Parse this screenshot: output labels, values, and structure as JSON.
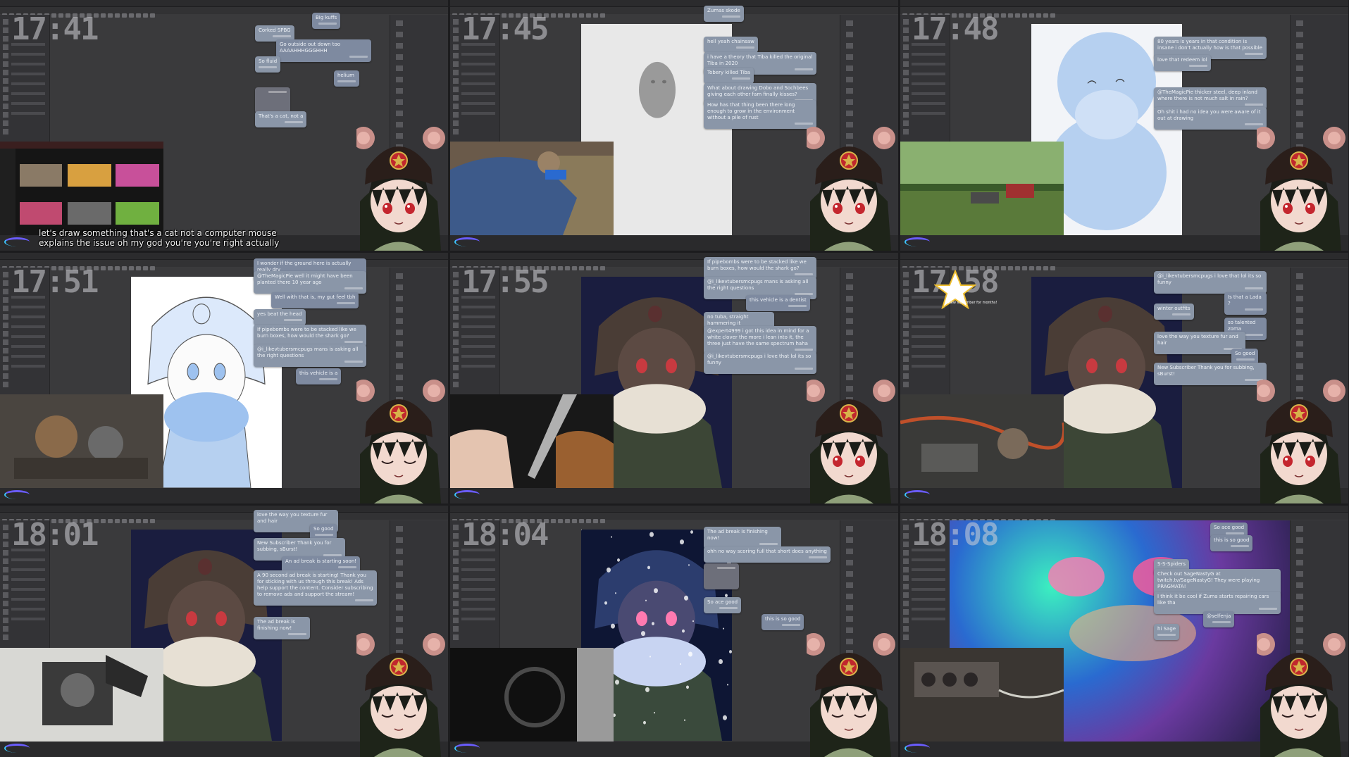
{
  "panels": [
    {
      "timer": "17:41",
      "canvas_theme": "dark",
      "subtitles": [
        "let's draw something that's a cat not a computer mouse",
        "explains the issue oh my god you're you're right actually"
      ],
      "chat": [
        {
          "side": "right",
          "text": "Big kuffs"
        },
        {
          "side": "left",
          "text": "Corked SPBG"
        },
        {
          "side": "right",
          "text": "Go outside out down too AAAAHHHGGGHHH"
        },
        {
          "side": "left",
          "text": "So fluid"
        },
        {
          "side": "right",
          "text": "helium"
        },
        {
          "side": "left",
          "text": ""
        },
        {
          "side": "left",
          "text": "That's a cat, not a"
        }
      ],
      "video": "browser-window"
    },
    {
      "timer": "17:45",
      "canvas_theme": "sketch-grey",
      "subtitles": [],
      "chat": [
        {
          "side": "left",
          "text": "Zumas skode"
        },
        {
          "side": "left",
          "text": "hell yeah chainsaw"
        },
        {
          "side": "left",
          "text": "i have a theory that Tiba killed the original Tiba in 2020"
        },
        {
          "side": "left",
          "text": "Tobery killed Tiba"
        },
        {
          "side": "left",
          "text": "What about drawing Dobo and Sochbees giving each other fam finally kisses?"
        },
        {
          "side": "left",
          "text": "How has that thing been there long enough to grow in the environment without a pile of rust"
        }
      ],
      "video": "chainsaw-worker"
    },
    {
      "timer": "17:48",
      "canvas_theme": "blue-lineart",
      "subtitles": [],
      "chat": [
        {
          "side": "left",
          "text": "80 years is years in that condition is insane i don't actually how is that possible"
        },
        {
          "side": "left",
          "text": "love that redeem lol"
        },
        {
          "side": "left",
          "text": "@TheMagicPie thicker steel, deep inland where there is not much salt in rain?"
        },
        {
          "side": "left",
          "text": "Oh shit i had no idea you were aware of it out at drawing"
        }
      ],
      "video": "forest-car"
    },
    {
      "timer": "17:51",
      "canvas_theme": "lineart-blue",
      "subtitles": [],
      "chat": [
        {
          "side": "right",
          "text": "I wonder if the ground here is actually really dry"
        },
        {
          "side": "left",
          "text": "@TheMagicPie well it might have been planted there 10 year ago"
        },
        {
          "side": "right",
          "text": "Well with that is, my gut feel tbh"
        },
        {
          "side": "left",
          "text": "yes beat the head"
        },
        {
          "side": "left",
          "text": "If pipebombs were to be stacked like we burn boxes, how would the shark go?"
        },
        {
          "side": "left",
          "text": "@i_likevtubersmcpugs mans is asking all the right questions"
        },
        {
          "side": "right",
          "text": "this vehicle is a"
        }
      ],
      "video": "engine-bay"
    },
    {
      "timer": "17:55",
      "canvas_theme": "dark-colored",
      "subtitles": [],
      "chat": [
        {
          "side": "left",
          "text": "If pipebombs were to be stacked like we burn boxes, how would the shark go?"
        },
        {
          "side": "left",
          "text": "@i_likevtubersmcpugs mans is asking all the right questions"
        },
        {
          "side": "right",
          "text": "this vehicle is a dentist"
        },
        {
          "side": "left",
          "text": "no tuba, straight hammering it"
        },
        {
          "side": "left",
          "text": "@expert4999 i got this idea in mind for a white clover the more i lean into it, the three just have the same spectrum haha"
        },
        {
          "side": "left",
          "text": "@i_likevtubersmcpugs i love that lol its so funny"
        }
      ],
      "video": "tool-hands"
    },
    {
      "timer": "17:58",
      "canvas_theme": "dark-colored",
      "subtitles": [],
      "alert": "New subscriber for months!",
      "chat": [
        {
          "side": "left",
          "text": "@i_likevtubersmcpugs i love that lol its so funny"
        },
        {
          "side": "right",
          "text": "Is that a Lada ?"
        },
        {
          "side": "left",
          "text": "winter outfits"
        },
        {
          "side": "right",
          "text": "so talented zoma"
        },
        {
          "side": "left",
          "text": "love the way you texture fur and hair"
        },
        {
          "side": "right",
          "text": "So good"
        },
        {
          "side": "left",
          "text": "New Subscriber Thank you for subbing, sBurst!"
        }
      ],
      "video": "engine-wires"
    },
    {
      "timer": "18:01",
      "canvas_theme": "dark-colored",
      "subtitles": [],
      "chat": [
        {
          "side": "left",
          "text": "love the way you texture fur and hair"
        },
        {
          "side": "right",
          "text": "So good"
        },
        {
          "side": "left",
          "text": "New Subscriber Thank you for subbing, sBurst!"
        },
        {
          "side": "right",
          "text": "An ad break is starting soon!"
        },
        {
          "side": "left",
          "text": "A 90 second ad break is starting! Thank you for sticking with us through this break! Ads help support the content. Consider subscribing to remove ads and support the stream!"
        },
        {
          "side": "left",
          "text": "The ad break is finishing now!"
        }
      ],
      "video": "carburetor"
    },
    {
      "timer": "18:04",
      "canvas_theme": "snowy",
      "subtitles": [],
      "chat": [
        {
          "side": "left",
          "text": "The ad break is finishing now!"
        },
        {
          "side": "left",
          "text": "ohh no way scoring full that short does anything"
        },
        {
          "side": "left",
          "text": ""
        },
        {
          "side": "left",
          "text": "So ace good"
        },
        {
          "side": "right",
          "text": "this is so good"
        }
      ],
      "video": "car-interior"
    },
    {
      "timer": "18:08",
      "canvas_theme": "neon-closeup",
      "subtitles": [],
      "chat": [
        {
          "side": "right",
          "text": "So ace good"
        },
        {
          "side": "right",
          "text": "this is so good"
        },
        {
          "side": "left",
          "text": "S-S-Spiders"
        },
        {
          "side": "left",
          "text": "Check out SageNastyG at twitch.tv/SageNastyG! They were playing PRAGMATA!"
        },
        {
          "side": "left",
          "text": "I think it be cool if Zuma starts repairing cars like tha"
        },
        {
          "side": "right",
          "text": "@selfenja"
        },
        {
          "side": "left",
          "text": "hi Sage"
        }
      ],
      "video": "engine-top"
    }
  ],
  "colors": {
    "app_bg": "#3a3a3c",
    "chat_bubble": "#8a96a8",
    "accent_purple": "#6a5cff",
    "accent_cyan": "#3cc8ff",
    "hat_red": "#c0272d",
    "hat_star": "#d8b34a"
  }
}
